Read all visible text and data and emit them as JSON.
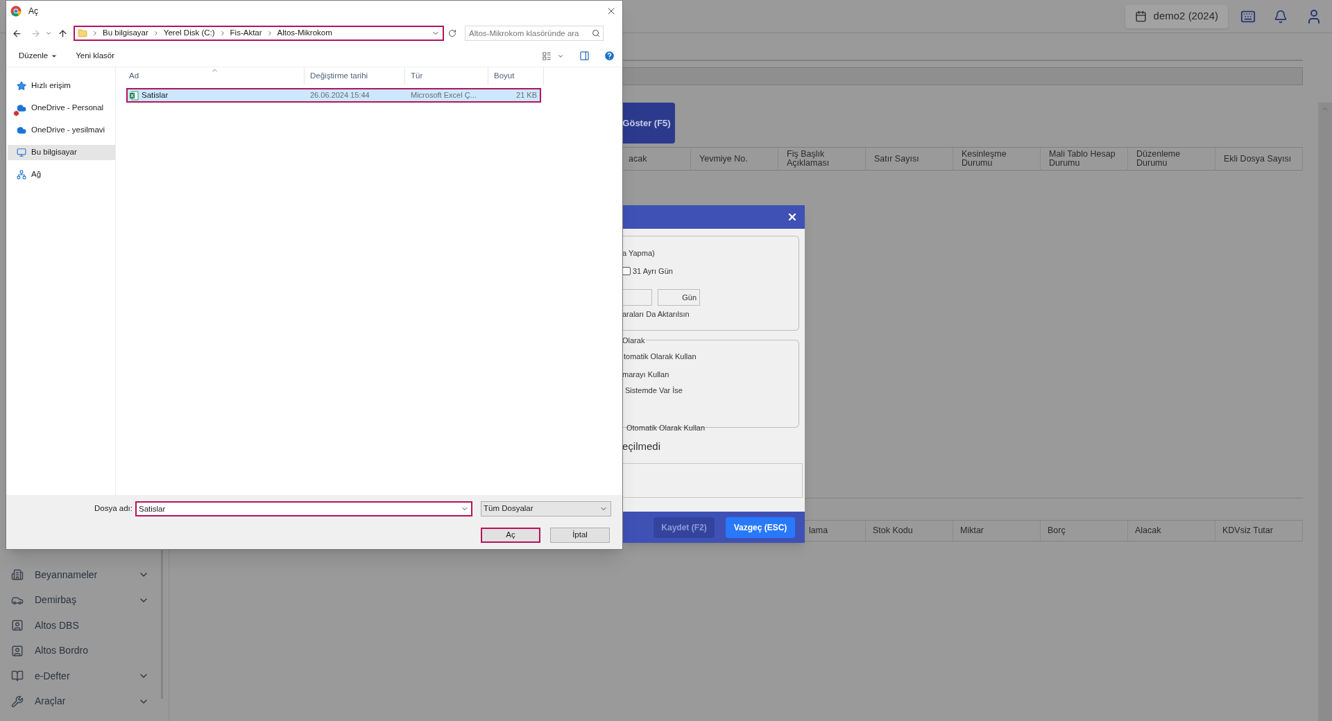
{
  "app": {
    "header": {
      "company_button": "demo2 (2024)"
    },
    "sidebar": {
      "items": [
        {
          "label": "Beyannameler",
          "expandable": true
        },
        {
          "label": "Demirbaş",
          "expandable": true
        },
        {
          "label": "Altos DBS",
          "expandable": false
        },
        {
          "label": "Altos Bordro",
          "expandable": false
        },
        {
          "label": "e-Defter",
          "expandable": true
        },
        {
          "label": "Araçlar",
          "expandable": true
        }
      ]
    },
    "main": {
      "show_button": "Göster (F5)",
      "table": {
        "columns": [
          "acak",
          "Yevmiye No.",
          "Fiş Başlık Açıklaması",
          "Satır Sayısı",
          "Kesinleşme Durumu",
          "Mali Tablo Hesap Durumu",
          "Düzenleme Durumu",
          "Ekli Dosya Sayısı"
        ]
      },
      "detail_table": {
        "columns": [
          "lama",
          "Stok Kodu",
          "Miktar",
          "Borç",
          "Alacak",
          "KDVsiz Tutar"
        ]
      }
    }
  },
  "modal": {
    "group_1": {
      "option_1": "a Yapma)",
      "checkbox": {
        "label": "31 Ayrı Gün",
        "checked": false
      },
      "day_field": "Gün",
      "option_2": "araları Da Aktarılsın"
    },
    "group_2": {
      "legend": "Olarak",
      "options": [
        "tomatik Olarak Kullan",
        "marayı Kullan",
        "Sistemde Var İse",
        "Otomatik Olarak Kullan"
      ]
    },
    "file_status": "eçilmedi",
    "buttons": [
      {
        "label": "Kaydet (F2)",
        "disabled": true
      },
      {
        "label": "Vazgeç (ESC)",
        "disabled": false
      }
    ]
  },
  "file_dialog": {
    "title": "Aç",
    "address": {
      "segments": [
        "Bu bilgisayar",
        "Yerel Disk (C:)",
        "Fis-Aktar",
        "Altos-Mikrokom"
      ],
      "highlighted": true
    },
    "search": {
      "placeholder": "Altos-Mikrokom klasöründe ara"
    },
    "toolbar": {
      "organize": "Düzenle",
      "new_folder": "Yeni klasör"
    },
    "nav": [
      {
        "label": "Hızlı erişim",
        "selected": false
      },
      {
        "label": "OneDrive - Personal",
        "selected": false
      },
      {
        "label": "OneDrive - yesilmavi",
        "selected": false
      },
      {
        "label": "Bu bilgisayar",
        "selected": true
      },
      {
        "label": "Ağ",
        "selected": false
      }
    ],
    "columns": [
      "Ad",
      "Değiştirme tarihi",
      "Tür",
      "Boyut"
    ],
    "files": [
      {
        "name": "Satislar",
        "modified": "26.06.2024 15:44",
        "type": "Microsoft Excel Ç...",
        "size": "21 KB",
        "selected": true,
        "highlighted": true
      }
    ],
    "filename": {
      "label": "Dosya adı:",
      "value": "Satislar",
      "highlighted": true
    },
    "filter": "Tüm Dosyalar",
    "buttons": [
      {
        "label": "Aç",
        "highlighted": true
      },
      {
        "label": "İptal",
        "highlighted": false
      }
    ]
  }
}
